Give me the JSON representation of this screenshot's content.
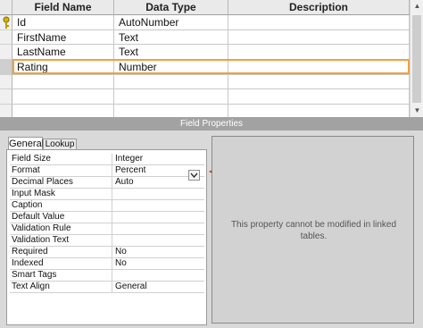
{
  "grid": {
    "headers": [
      "Field Name",
      "Data Type",
      "Description"
    ],
    "rows": [
      {
        "name": "Id",
        "type": "AutoNumber",
        "key": true
      },
      {
        "name": "FirstName",
        "type": "Text"
      },
      {
        "name": "LastName",
        "type": "Text"
      },
      {
        "name": "Rating",
        "type": "Number",
        "current": true
      }
    ]
  },
  "field_properties": {
    "title": "Field Properties",
    "tabs": [
      "General",
      "Lookup"
    ],
    "active_tab": "General",
    "properties": [
      {
        "label": "Field Size",
        "value": "Integer"
      },
      {
        "label": "Format",
        "value": "Percent"
      },
      {
        "label": "Decimal Places",
        "value": "Auto"
      },
      {
        "label": "Input Mask",
        "value": ""
      },
      {
        "label": "Caption",
        "value": ""
      },
      {
        "label": "Default Value",
        "value": ""
      },
      {
        "label": "Validation Rule",
        "value": ""
      },
      {
        "label": "Validation Text",
        "value": ""
      },
      {
        "label": "Required",
        "value": "No"
      },
      {
        "label": "Indexed",
        "value": "No"
      },
      {
        "label": "Smart Tags",
        "value": ""
      },
      {
        "label": "Text Align",
        "value": "General"
      }
    ],
    "info_text": "This property cannot be modified in linked tables."
  },
  "icons": {
    "key": "key-icon",
    "dropdown": "dropdown-arrow-icon",
    "arrow": "red-arrow-annotation",
    "scroll_up": "scroll-up-icon",
    "scroll_down": "scroll-down-icon"
  },
  "colors": {
    "selection_border": "#f0a040",
    "annotation_arrow": "#e0201b"
  }
}
